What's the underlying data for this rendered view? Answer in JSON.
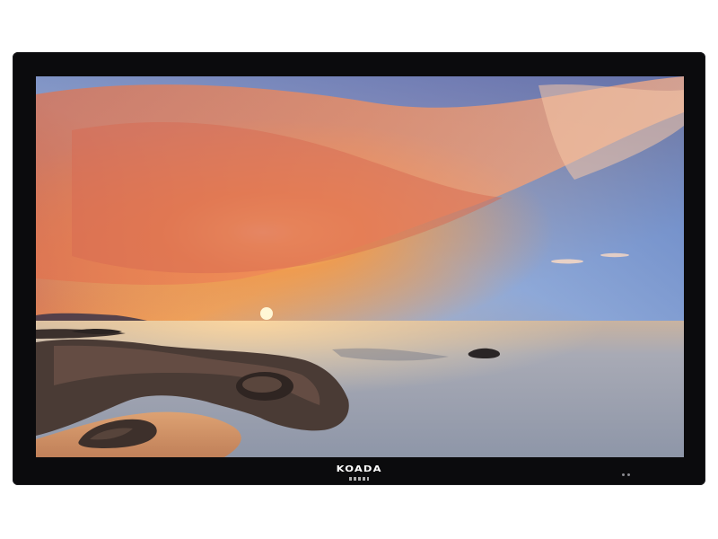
{
  "product": {
    "brand_name": "KOADA"
  },
  "colors": {
    "bezel": "#0b0b0d",
    "sky_top": "#3e3f73",
    "sky_glow": "#f18a3c",
    "sun": "#fff3c2",
    "sea": "#9aa3b3",
    "rock": "#3b2e2a"
  }
}
